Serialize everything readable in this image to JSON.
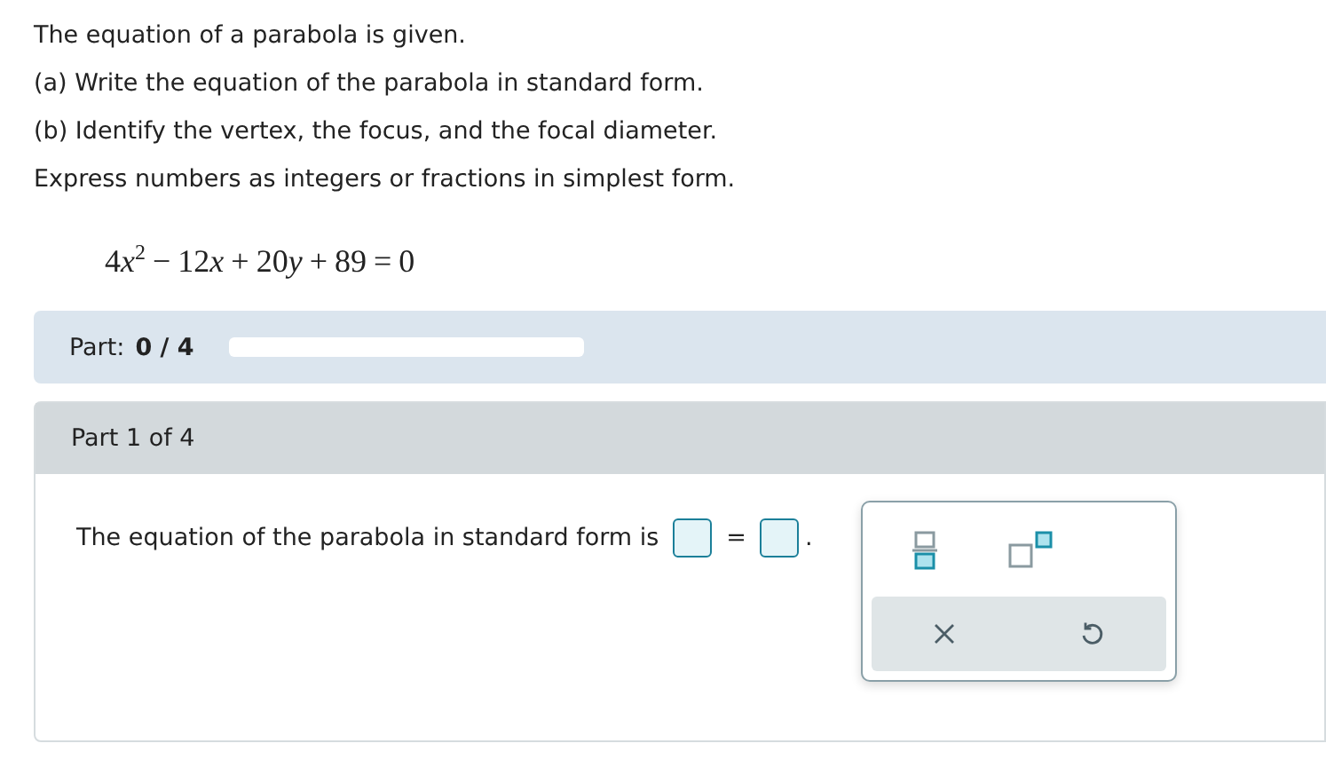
{
  "intro": [
    "The equation of a parabola is given.",
    "(a) Write the equation of the parabola in standard form.",
    "(b) Identify the vertex, the focus, and the focal diameter.",
    "Express numbers as integers or fractions in simplest form."
  ],
  "equation": [
    {
      "kind": "num",
      "text": "4"
    },
    {
      "kind": "var",
      "text": "x"
    },
    {
      "kind": "sup",
      "text": "2"
    },
    {
      "kind": "op",
      "text": "−"
    },
    {
      "kind": "num",
      "text": "12"
    },
    {
      "kind": "var",
      "text": "x"
    },
    {
      "kind": "op",
      "text": "+"
    },
    {
      "kind": "num",
      "text": "20"
    },
    {
      "kind": "var",
      "text": "y"
    },
    {
      "kind": "op",
      "text": "+"
    },
    {
      "kind": "num",
      "text": "89"
    },
    {
      "kind": "op",
      "text": "="
    },
    {
      "kind": "num",
      "text": "0"
    }
  ],
  "progress": {
    "label": "Part:",
    "value": "0 / 4",
    "level": 0
  },
  "part": {
    "title": "Part 1 of 4",
    "prompt": "The equation of the parabola in standard form is",
    "equals": "=",
    "period": "."
  }
}
